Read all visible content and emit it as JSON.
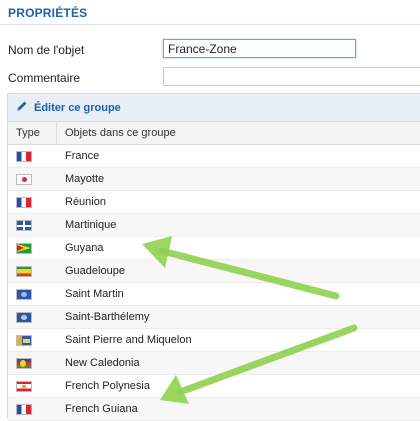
{
  "section": {
    "title": "PROPRIÉTÉS"
  },
  "form": {
    "name_label": "Nom de l'objet",
    "name_value": "France-Zone",
    "comment_label": "Commentaire",
    "comment_value": ""
  },
  "group": {
    "edit_label": "Éditer ce groupe",
    "col_type": "Type",
    "col_objects": "Objets dans ce groupe",
    "rows": [
      {
        "name": "France",
        "icon": "flag-france-icon"
      },
      {
        "name": "Mayotte",
        "icon": "flag-mayotte-icon"
      },
      {
        "name": "Réunion",
        "icon": "flag-reunion-icon"
      },
      {
        "name": "Martinique",
        "icon": "flag-martinique-icon"
      },
      {
        "name": "Guyana",
        "icon": "flag-guyana-icon"
      },
      {
        "name": "Guadeloupe",
        "icon": "flag-guadeloupe-icon"
      },
      {
        "name": "Saint Martin",
        "icon": "flag-saint-martin-icon"
      },
      {
        "name": "Saint-Barthélemy",
        "icon": "flag-saint-barthelemy-icon"
      },
      {
        "name": "Saint Pierre and Miquelon",
        "icon": "flag-saint-pierre-miquelon-icon"
      },
      {
        "name": "New Caledonia",
        "icon": "flag-new-caledonia-icon"
      },
      {
        "name": "French Polynesia",
        "icon": "flag-french-polynesia-icon"
      },
      {
        "name": "French Guiana",
        "icon": "flag-french-guiana-icon"
      }
    ]
  },
  "colors": {
    "accent": "#1f63a6",
    "header_bg": "#e7eef6",
    "arrow": "#8fd14f"
  }
}
